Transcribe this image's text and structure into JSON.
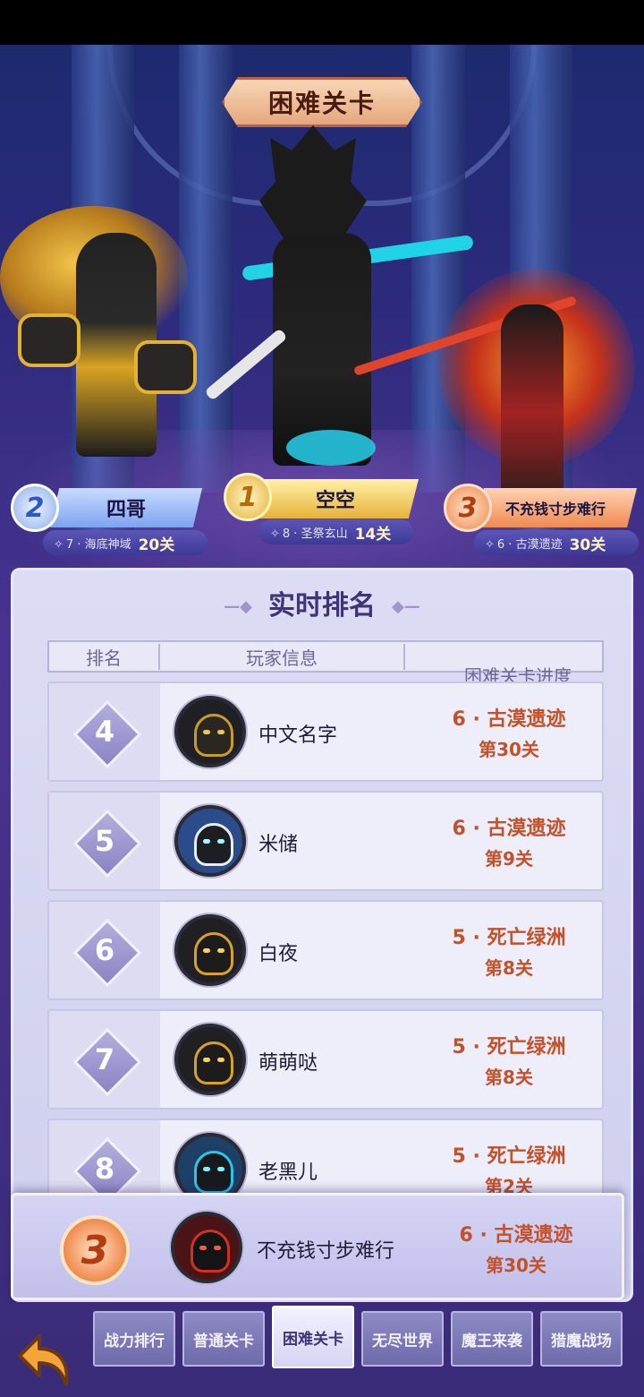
{
  "header": {
    "title": "困难关卡"
  },
  "podium": [
    {
      "rank": "2",
      "name": "四哥",
      "level": "7 · 海底神域",
      "stage": "20关"
    },
    {
      "rank": "1",
      "name": "空空",
      "level": "8 · 圣祭玄山",
      "stage": "14关"
    },
    {
      "rank": "3",
      "name": "不充钱寸步难行",
      "level": "6 · 古漠遗迹",
      "stage": "30关"
    }
  ],
  "ranking": {
    "title": "实时排名",
    "columns": {
      "rank": "排名",
      "info": "玩家信息",
      "progress": "困难关卡进度"
    },
    "rows": [
      {
        "rank": "4",
        "name": "中文名字",
        "world": "6 · 古漠遗迹",
        "stage": "第30关"
      },
      {
        "rank": "5",
        "name": "米储",
        "world": "6 · 古漠遗迹",
        "stage": "第9关"
      },
      {
        "rank": "6",
        "name": "白夜",
        "world": "5 · 死亡绿洲",
        "stage": "第8关"
      },
      {
        "rank": "7",
        "name": "萌萌哒",
        "world": "5 · 死亡绿洲",
        "stage": "第8关"
      },
      {
        "rank": "8",
        "name": "老黑儿",
        "world": "5 · 死亡绿洲",
        "stage": "第2关"
      }
    ],
    "self": {
      "rank": "3",
      "name": "不充钱寸步难行",
      "world": "6 · 古漠遗迹",
      "stage": "第30关"
    }
  },
  "tabs": [
    {
      "label": "战力排行",
      "active": false
    },
    {
      "label": "普通关卡",
      "active": false
    },
    {
      "label": "困难关卡",
      "active": true
    },
    {
      "label": "无尽世界",
      "active": false
    },
    {
      "label": "魔王来袭",
      "active": false
    },
    {
      "label": "猎魔战场",
      "active": false
    }
  ],
  "icons": {
    "back": "back-arrow-icon",
    "level_star": "star-icon"
  },
  "colors": {
    "accent": "#c4512a",
    "panel": "#d6d4f4",
    "tab": "#7a76b6"
  }
}
